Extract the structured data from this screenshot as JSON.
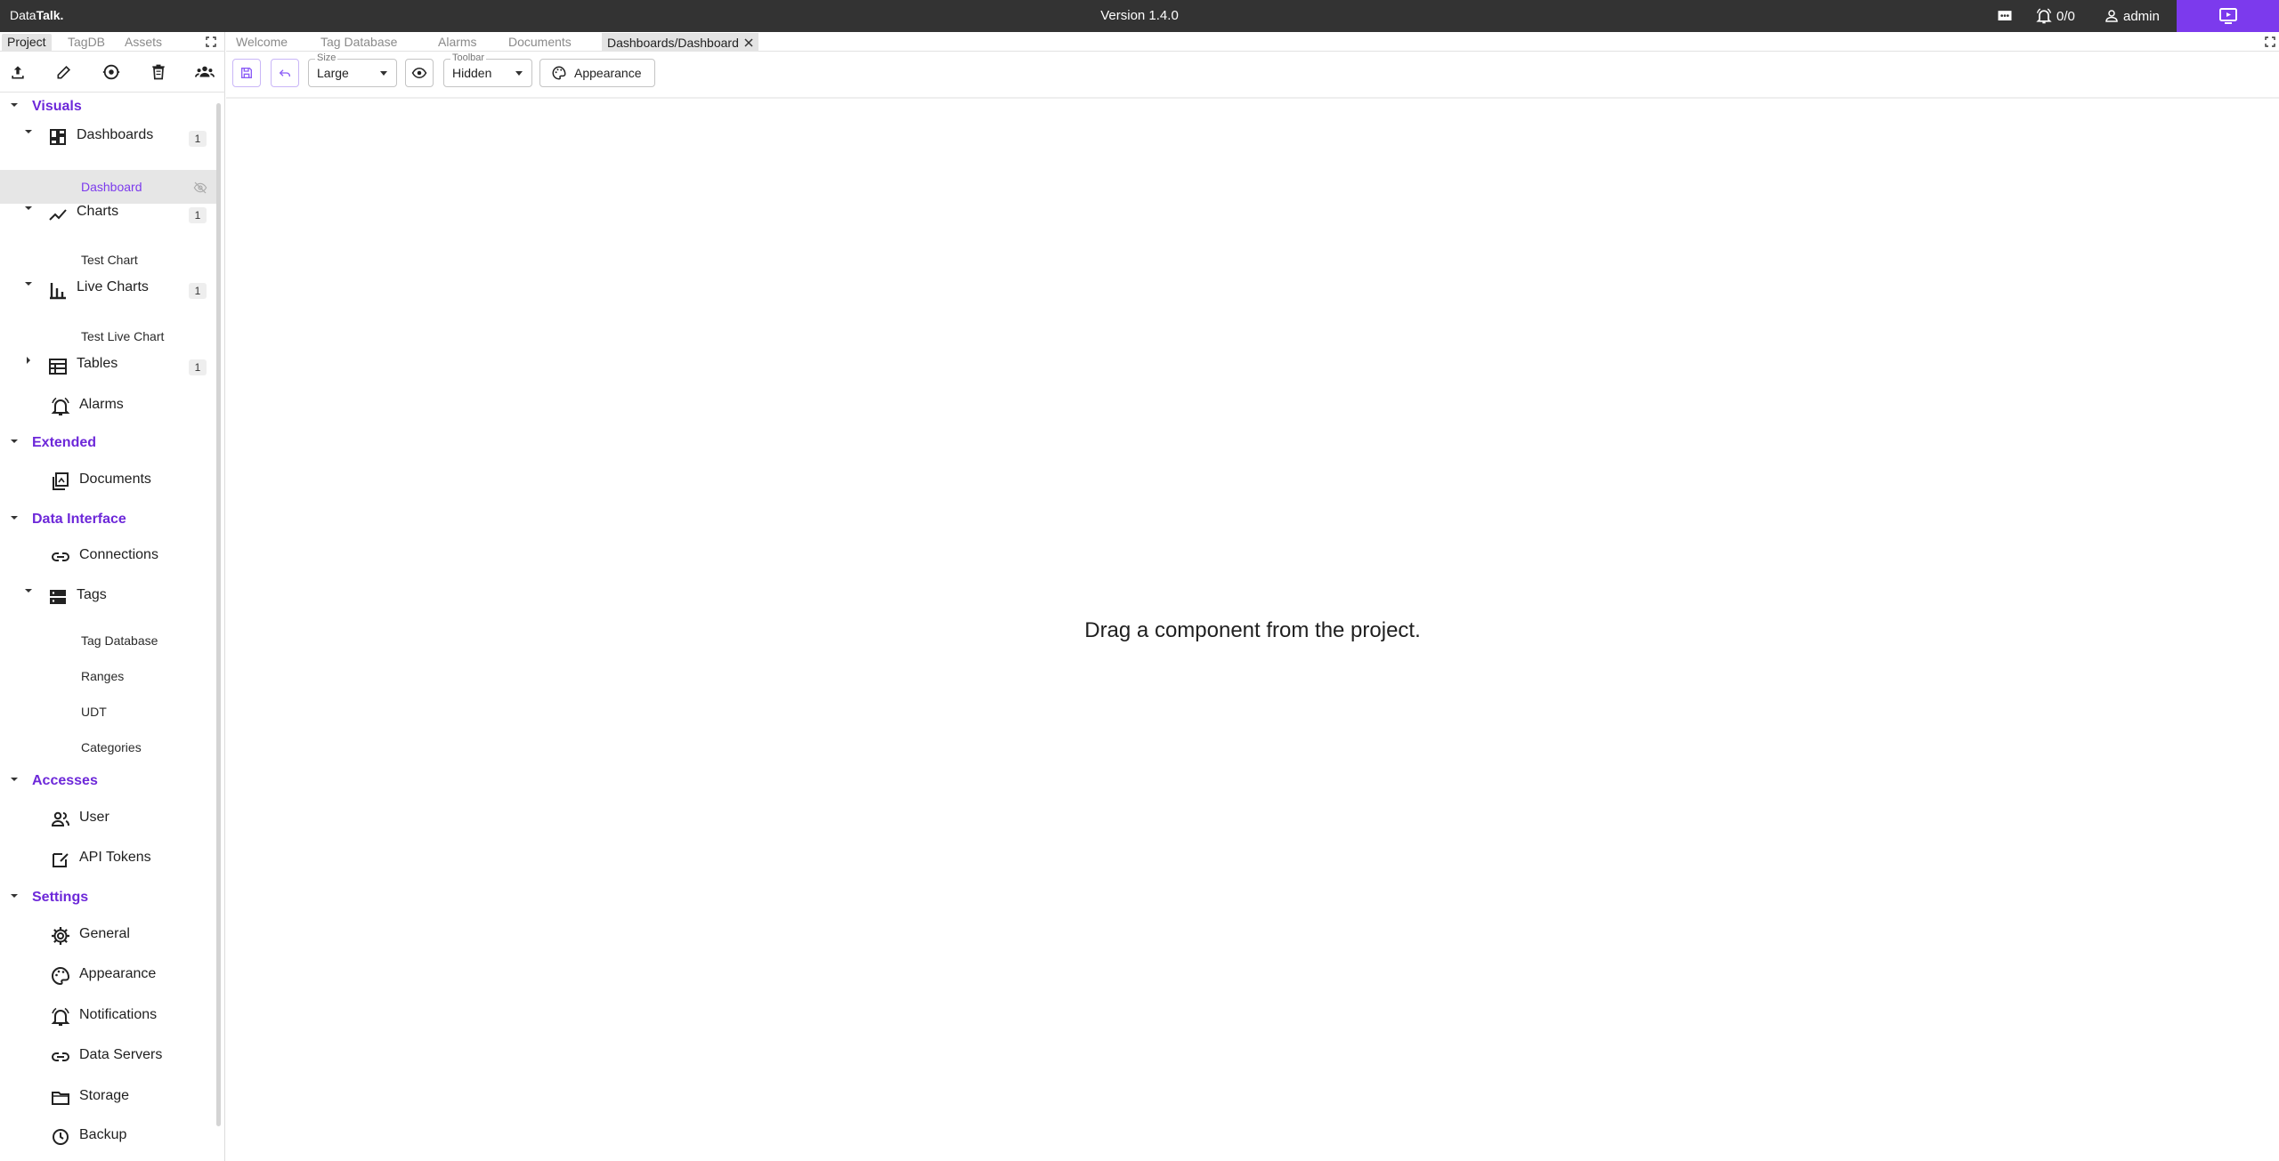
{
  "titlebar": {
    "brand_prefix": "Data",
    "brand_bold": "Talk.",
    "version": "Version 1.4.0",
    "alarm_count": "0/0",
    "user": "admin",
    "accent_color": "#7c3aed"
  },
  "left_tabs": [
    "Project",
    "TagDB",
    "Assets"
  ],
  "left_tools": [
    "upload-icon",
    "edit-icon",
    "sync-icon",
    "delete-icon",
    "group-icon"
  ],
  "tree": {
    "visuals": {
      "label": "Visuals",
      "dashboards": {
        "label": "Dashboards",
        "count": "1",
        "children": [
          "Dashboard"
        ]
      },
      "charts": {
        "label": "Charts",
        "count": "1",
        "children": [
          "Test Chart"
        ]
      },
      "live_charts": {
        "label": "Live Charts",
        "count": "1",
        "children": [
          "Test Live Chart"
        ]
      },
      "tables": {
        "label": "Tables",
        "count": "1"
      },
      "alarms": {
        "label": "Alarms"
      }
    },
    "extended": {
      "label": "Extended",
      "documents": {
        "label": "Documents"
      }
    },
    "data_interface": {
      "label": "Data Interface",
      "connections": {
        "label": "Connections"
      },
      "tags": {
        "label": "Tags",
        "children": [
          "Tag Database",
          "Ranges",
          "UDT",
          "Categories"
        ]
      }
    },
    "accesses": {
      "label": "Accesses",
      "user": {
        "label": "User"
      },
      "api_tokens": {
        "label": "API Tokens"
      }
    },
    "settings": {
      "label": "Settings",
      "general": {
        "label": "General"
      },
      "appearance": {
        "label": "Appearance"
      },
      "notifications": {
        "label": "Notifications"
      },
      "data_servers": {
        "label": "Data Servers"
      },
      "storage": {
        "label": "Storage"
      },
      "backup": {
        "label": "Backup"
      }
    }
  },
  "doc_tabs": [
    "Welcome",
    "Tag Database",
    "Alarms",
    "Documents",
    "Dashboards/Dashboard"
  ],
  "toolbar": {
    "size_legend": "Size",
    "size_value": "Large",
    "toolbar_legend": "Toolbar",
    "toolbar_value": "Hidden",
    "appearance_label": "Appearance"
  },
  "canvas": {
    "empty_message": "Drag a component from the project."
  }
}
